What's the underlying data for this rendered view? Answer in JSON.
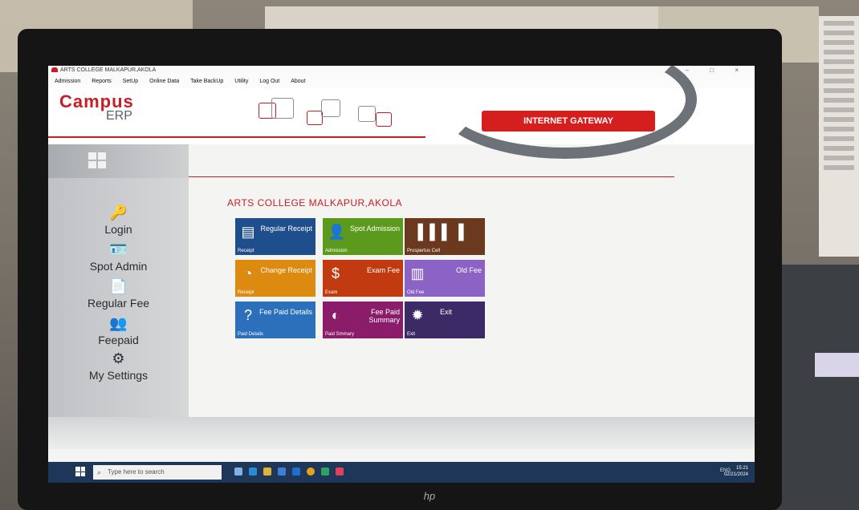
{
  "window": {
    "title": "ARTS COLLEGE MALKAPUR,AKOLA",
    "controls": "– □ ×"
  },
  "menu": [
    "Admission",
    "Reports",
    "SetUp",
    "Online Data",
    "Take BackUp",
    "Utility",
    "Log Out",
    "About"
  ],
  "header": {
    "logo_line1": "Campus",
    "logo_line2": "ERP",
    "gateway_label": "INTERNET GATEWAY"
  },
  "sidebar": {
    "items": [
      {
        "label": "Login",
        "icon": "key-icon"
      },
      {
        "label": "Spot Admin",
        "icon": "student-card-icon"
      },
      {
        "label": "Regular Fee",
        "icon": "document-icon"
      },
      {
        "label": "Feepaid",
        "icon": "users-icon"
      },
      {
        "label": "My Settings",
        "icon": "settings-users-icon"
      }
    ]
  },
  "main": {
    "college_name": "ARTS COLLEGE MALKAPUR,AKOLA",
    "tiles": [
      {
        "label": "Regular Receipt",
        "sub": "Receipt",
        "color": "#1f4e8c",
        "icon": "receipt-icon"
      },
      {
        "label": "Spot Admission",
        "sub": "Admission",
        "color": "#5c9a1e",
        "icon": "person-icon"
      },
      {
        "label": "",
        "sub": "Prospertus Cell",
        "color": "#6b3a1e",
        "icon": "bars-chart-icon"
      },
      {
        "label": "Change Receipt",
        "sub": "Receipt",
        "color": "#dd8a10",
        "icon": "pie-icon"
      },
      {
        "label": "Exam Fee",
        "sub": "Exam",
        "color": "#c23a10",
        "icon": "dollar-icon"
      },
      {
        "label": "Old Fee",
        "sub": "Old Fee",
        "color": "#8a63c4",
        "icon": "book-icon"
      },
      {
        "label": "Fee Paid Details",
        "sub": "Paid Details",
        "color": "#2c6fba",
        "icon": "question-icon"
      },
      {
        "label": "Fee Paid Summary",
        "sub": "Paid Smmary",
        "color": "#8a1c6a",
        "icon": "crescent-icon"
      },
      {
        "label": "Exit",
        "sub": "Exit",
        "color": "#3b2a66",
        "icon": "gear-sun-icon"
      }
    ]
  },
  "taskbar": {
    "search_placeholder": "Type here to search",
    "tray_text": "ENG",
    "time": "15:21",
    "date": "02/21/2024"
  },
  "monitor_brand": "hp"
}
